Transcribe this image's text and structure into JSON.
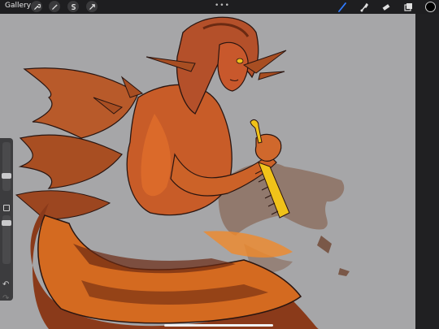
{
  "toolbar": {
    "gallery_label": "Gallery",
    "left_tools": [
      "wrench-icon",
      "magic-wand-icon",
      "selection-icon",
      "transform-icon"
    ],
    "more_label": "•••",
    "right_tools": [
      "brush-icon",
      "smudge-icon",
      "eraser-icon",
      "layers-icon"
    ],
    "active_tool": "brush",
    "current_color": "#000000"
  },
  "sidebar": {
    "undo_label": "↶",
    "redo_label": "↷"
  },
  "colors": {
    "accent": "#2f7bff",
    "canvas_bg": "#a6a6a8",
    "comb": "#f0c21a"
  }
}
